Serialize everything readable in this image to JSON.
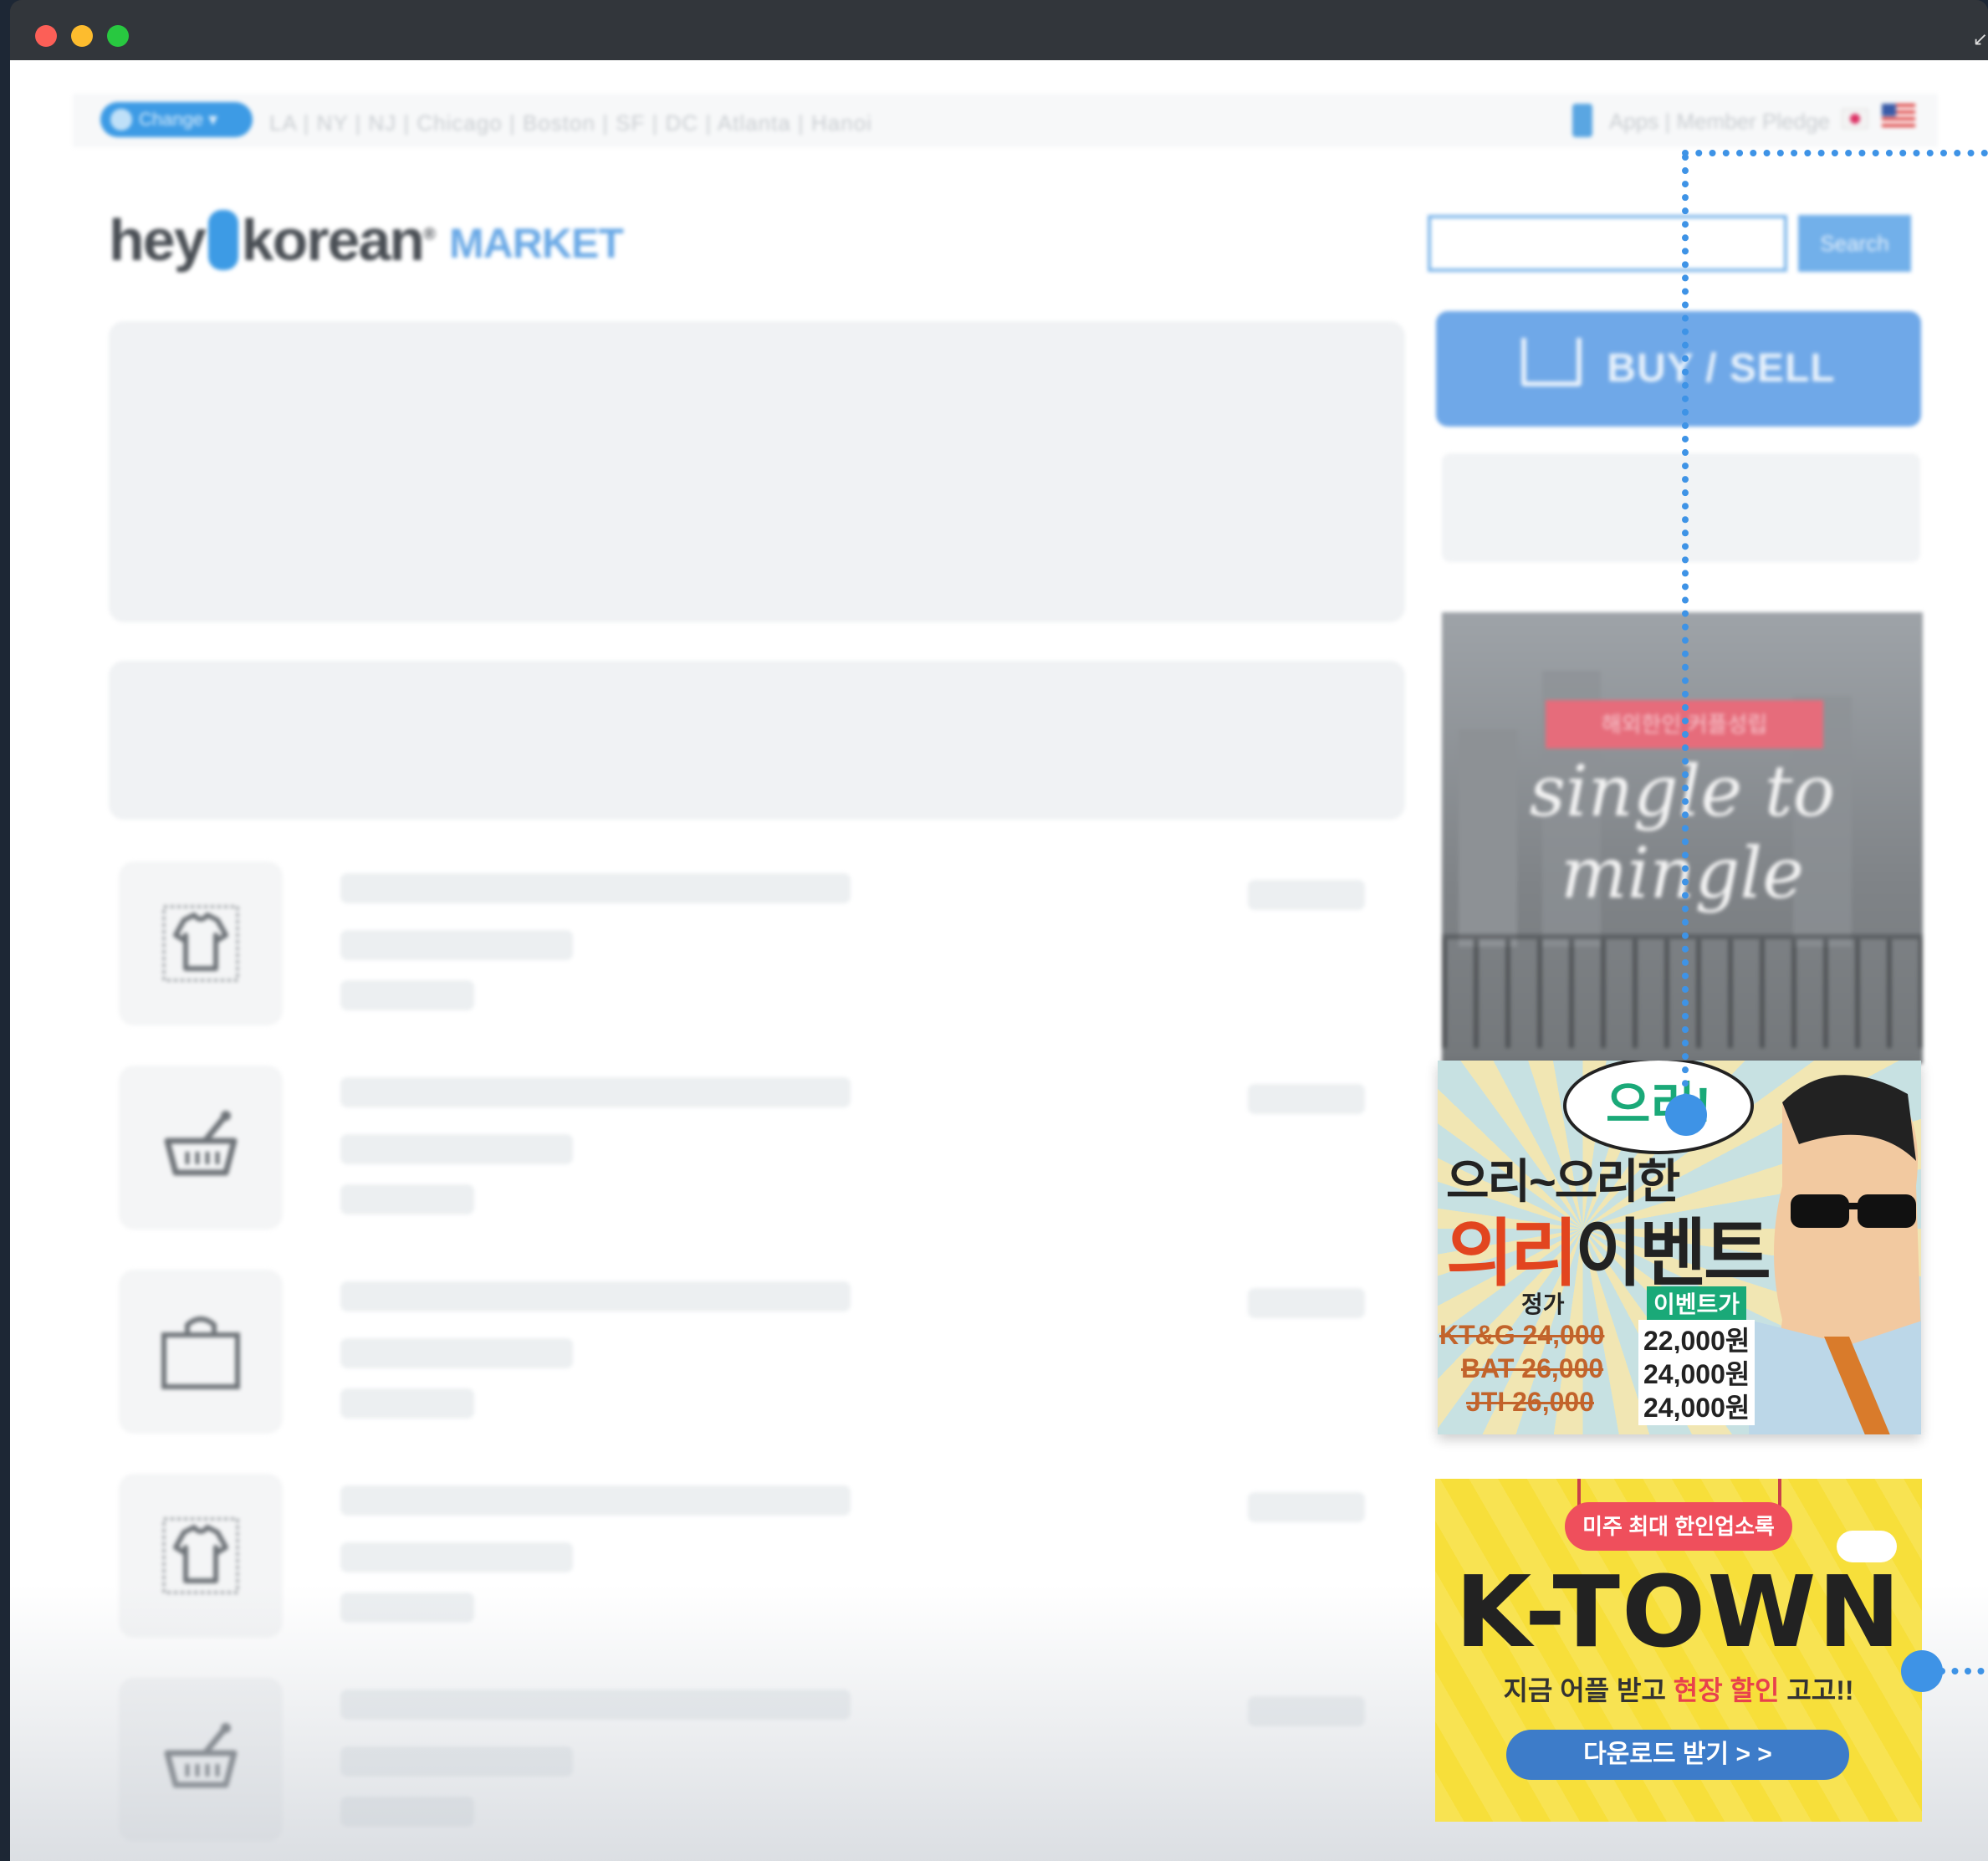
{
  "topbar": {
    "change_label": "Change ▾",
    "cities": "LA | NY | NJ | Chicago | Boston | SF | DC | Atlanta | Hanoi",
    "links": "Apps | Member Pledge"
  },
  "logo": {
    "hey": "hey",
    "korean": "korean",
    "mark": "®",
    "market": "MARKET"
  },
  "search": {
    "placeholder": "",
    "button": "Search"
  },
  "buy_sell": {
    "label": "BUY / SELL"
  },
  "sidebar_ads": {
    "single_to_mingle": {
      "ribbon": "해외한인 커플성립",
      "title": "single to mingle"
    },
    "uiri": {
      "bubble": "으리!",
      "sub": "으리~으리한",
      "big_red": "의리",
      "big_black": "이벤트",
      "label_regular": "정가",
      "label_event": "이벤트가",
      "rows": [
        {
          "brand": "KT&G 24,000",
          "price": "22,000원"
        },
        {
          "brand": "BAT 26,000",
          "price": "24,000원"
        },
        {
          "brand": "JTI 26,000",
          "price": "24,000원"
        }
      ]
    },
    "ktown": {
      "tag": "미주 최대 한인업소록",
      "title": "K-TOWN",
      "slogan_pre": "지금 어플 받고 ",
      "slogan_hl": "현장 할인",
      "slogan_post": " 고고!!",
      "download": "다운로드 받기 > >"
    }
  },
  "colors": {
    "accent": "#3e93e6",
    "brand_blue": "#3d9be5",
    "ad_yellow": "#f7df3a"
  },
  "icons": [
    "shirt-icon",
    "basket-icon",
    "shopping-bag-icon",
    "shirt-icon",
    "basket-icon"
  ]
}
